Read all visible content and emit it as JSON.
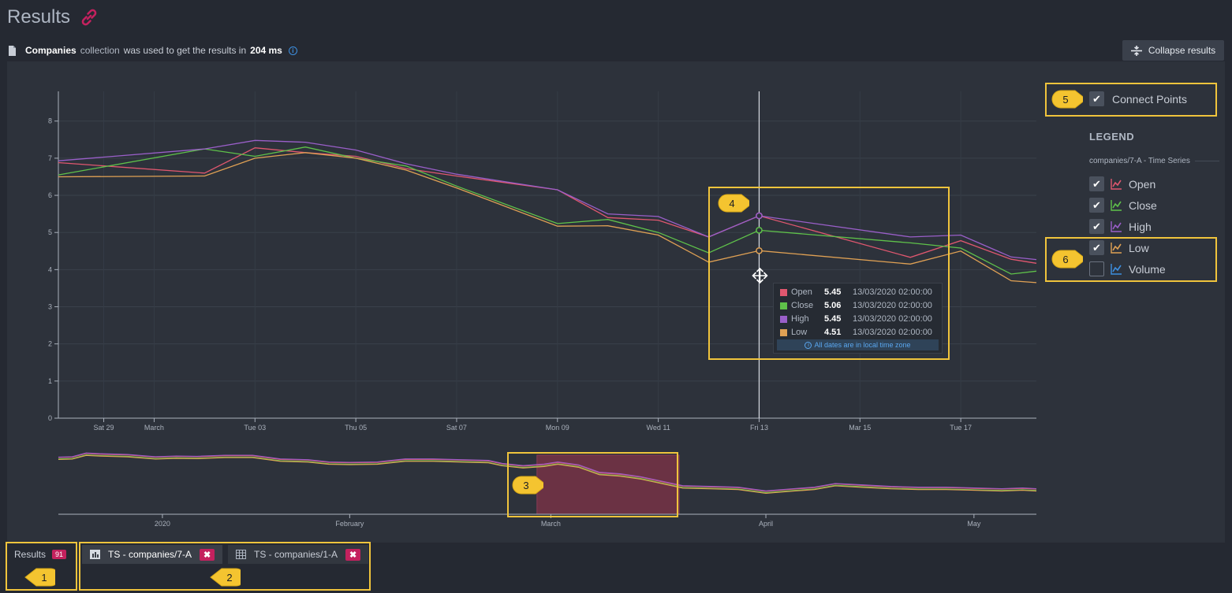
{
  "header": {
    "title": "Results",
    "collection_name": "Companies",
    "collection_text": "collection",
    "info_text": "was used to get the results in",
    "duration": "204 ms"
  },
  "collapse_button": {
    "label": "Collapse results",
    "icon": "collapse-icon"
  },
  "chart_controls": {
    "connect_points_label": "Connect Points",
    "connect_points_checked": true
  },
  "legend": {
    "title": "LEGEND",
    "series_group": "companies/7-A - Time Series",
    "items": [
      {
        "label": "Open",
        "checked": true,
        "color": "#e0576f"
      },
      {
        "label": "Close",
        "checked": true,
        "color": "#5fc24a"
      },
      {
        "label": "High",
        "checked": true,
        "color": "#9a5fc9"
      },
      {
        "label": "Low",
        "checked": true,
        "color": "#e0a154"
      },
      {
        "label": "Volume",
        "checked": false,
        "color": "#3d8fe0"
      }
    ]
  },
  "tooltip": {
    "rows": [
      {
        "label": "Open",
        "value": "5.45",
        "date": "13/03/2020 02:00:00",
        "color": "#e0576f"
      },
      {
        "label": "Close",
        "value": "5.06",
        "date": "13/03/2020 02:00:00",
        "color": "#5fc24a"
      },
      {
        "label": "High",
        "value": "5.45",
        "date": "13/03/2020 02:00:00",
        "color": "#9a5fc9"
      },
      {
        "label": "Low",
        "value": "4.51",
        "date": "13/03/2020 02:00:00",
        "color": "#e0a154"
      }
    ],
    "footer": "All dates are in local time zone"
  },
  "callouts": [
    "1",
    "2",
    "3",
    "4",
    "5",
    "6"
  ],
  "tabs": {
    "results_label": "Results",
    "results_count": "91",
    "items": [
      {
        "label": "TS - companies/7-A",
        "active": true,
        "icon": "chart-icon"
      },
      {
        "label": "TS - companies/1-A",
        "active": false,
        "icon": "table-icon"
      }
    ]
  },
  "chart_data": {
    "type": "line",
    "y_ticks": [
      "0",
      "1",
      "2",
      "3",
      "4",
      "5",
      "6",
      "7",
      "8"
    ],
    "ylim": [
      0,
      8.8
    ],
    "x_tick_labels": [
      "Sat 29",
      "March",
      "Tue 03",
      "Thu 05",
      "Sat 07",
      "Mon 09",
      "Wed 11",
      "Fri 13",
      "Mar 15",
      "Tue 17"
    ],
    "x_tick_days": [
      -1,
      0,
      2,
      4,
      6,
      8,
      10,
      12,
      14,
      16
    ],
    "xlim_days": [
      -1.9,
      17.5
    ],
    "hover_day": 12,
    "x": [
      -1.9,
      1,
      2,
      3,
      4,
      5,
      6,
      8,
      9,
      10,
      11,
      12,
      15,
      16,
      17,
      17.5
    ],
    "series": [
      {
        "name": "Open",
        "color": "#e0576f",
        "values": [
          6.88,
          6.6,
          7.28,
          7.15,
          7.05,
          6.72,
          6.52,
          6.15,
          5.4,
          5.33,
          4.88,
          5.45,
          4.33,
          4.78,
          4.28,
          4.17
        ]
      },
      {
        "name": "Close",
        "color": "#5fc24a",
        "values": [
          6.55,
          7.25,
          7.05,
          7.3,
          7.0,
          6.79,
          6.25,
          5.24,
          5.35,
          5.0,
          4.45,
          5.06,
          4.72,
          4.58,
          3.88,
          3.96
        ]
      },
      {
        "name": "High",
        "color": "#9a5fc9",
        "values": [
          6.93,
          7.25,
          7.48,
          7.43,
          7.22,
          6.85,
          6.57,
          6.15,
          5.5,
          5.43,
          4.88,
          5.45,
          4.88,
          4.93,
          4.34,
          4.27
        ]
      },
      {
        "name": "Low",
        "color": "#e0a154",
        "values": [
          6.5,
          6.52,
          7.0,
          7.15,
          7.0,
          6.68,
          6.2,
          5.17,
          5.18,
          4.93,
          4.2,
          4.51,
          4.15,
          4.5,
          3.7,
          3.65
        ]
      }
    ],
    "navigator": {
      "x_labels": [
        "2020",
        "February",
        "March",
        "April",
        "May"
      ],
      "x_label_days": [
        -57,
        -30,
        -1,
        30,
        60
      ],
      "xlim_days": [
        -72,
        69
      ],
      "selection_days": [
        -3,
        17.5
      ],
      "ylim": [
        0,
        8.8
      ],
      "x": [
        -72,
        -70,
        -68,
        -66,
        -62,
        -58,
        -55,
        -52,
        -48,
        -44,
        -40,
        -36,
        -33,
        -30,
        -26,
        -22,
        -18,
        -14,
        -10,
        -8,
        -5,
        -2,
        0,
        3,
        6,
        9,
        12,
        15,
        18,
        22,
        26,
        30,
        34,
        37,
        40,
        44,
        48,
        52,
        56,
        60,
        64,
        67,
        69
      ],
      "values": [
        7.55,
        7.6,
        8.1,
        8.0,
        7.9,
        7.6,
        7.7,
        7.65,
        7.8,
        7.8,
        7.3,
        7.2,
        6.9,
        6.85,
        6.9,
        7.3,
        7.3,
        7.2,
        7.1,
        6.7,
        6.4,
        6.6,
        6.9,
        6.5,
        5.5,
        5.3,
        4.9,
        4.3,
        3.7,
        3.6,
        3.5,
        3.0,
        3.3,
        3.5,
        4.0,
        3.8,
        3.6,
        3.5,
        3.5,
        3.4,
        3.3,
        3.4,
        3.3
      ]
    }
  }
}
